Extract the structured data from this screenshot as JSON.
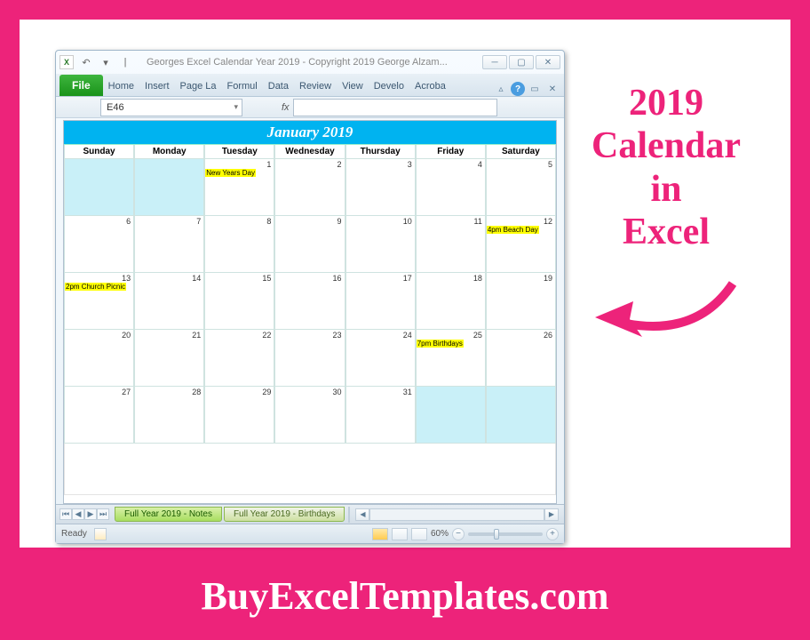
{
  "promo": {
    "line1": "2019",
    "line2": "Calendar",
    "line3": "in",
    "line4": "Excel"
  },
  "footer": "BuyExcelTemplates.com",
  "window": {
    "title": "Georges Excel Calendar Year 2019 - Copyright 2019 George Alzam...",
    "excel_abbrev": "X"
  },
  "ribbon": {
    "file": "File",
    "tabs": [
      "Home",
      "Insert",
      "Page La",
      "Formul",
      "Data",
      "Review",
      "View",
      "Develo",
      "Acroba"
    ]
  },
  "namebox": {
    "cell": "E46",
    "fx": "fx"
  },
  "calendar": {
    "title": "January 2019",
    "days": [
      "Sunday",
      "Monday",
      "Tuesday",
      "Wednesday",
      "Thursday",
      "Friday",
      "Saturday"
    ],
    "rows": [
      [
        {
          "num": "",
          "shade": "blue"
        },
        {
          "num": "",
          "shade": "blue"
        },
        {
          "num": "1",
          "event": "New Years Day"
        },
        {
          "num": "2"
        },
        {
          "num": "3"
        },
        {
          "num": "4"
        },
        {
          "num": "5"
        }
      ],
      [
        {
          "num": "6"
        },
        {
          "num": "7"
        },
        {
          "num": "8"
        },
        {
          "num": "9"
        },
        {
          "num": "10"
        },
        {
          "num": "11"
        },
        {
          "num": "12",
          "event": "4pm Beach Day"
        }
      ],
      [
        {
          "num": "13",
          "event": "2pm Church Picnic"
        },
        {
          "num": "14"
        },
        {
          "num": "15"
        },
        {
          "num": "16"
        },
        {
          "num": "17"
        },
        {
          "num": "18"
        },
        {
          "num": "19"
        }
      ],
      [
        {
          "num": "20"
        },
        {
          "num": "21"
        },
        {
          "num": "22"
        },
        {
          "num": "23"
        },
        {
          "num": "24"
        },
        {
          "num": "25",
          "event": "7pm Birthdays"
        },
        {
          "num": "26"
        }
      ],
      [
        {
          "num": "27"
        },
        {
          "num": "28"
        },
        {
          "num": "29"
        },
        {
          "num": "30"
        },
        {
          "num": "31"
        },
        {
          "num": "",
          "shade": "blue"
        },
        {
          "num": "",
          "shade": "blue"
        }
      ]
    ]
  },
  "sheet_tabs": [
    "Full Year 2019 - Notes",
    "Full Year 2019 - Birthdays"
  ],
  "status": {
    "ready": "Ready",
    "zoom": "60%"
  }
}
